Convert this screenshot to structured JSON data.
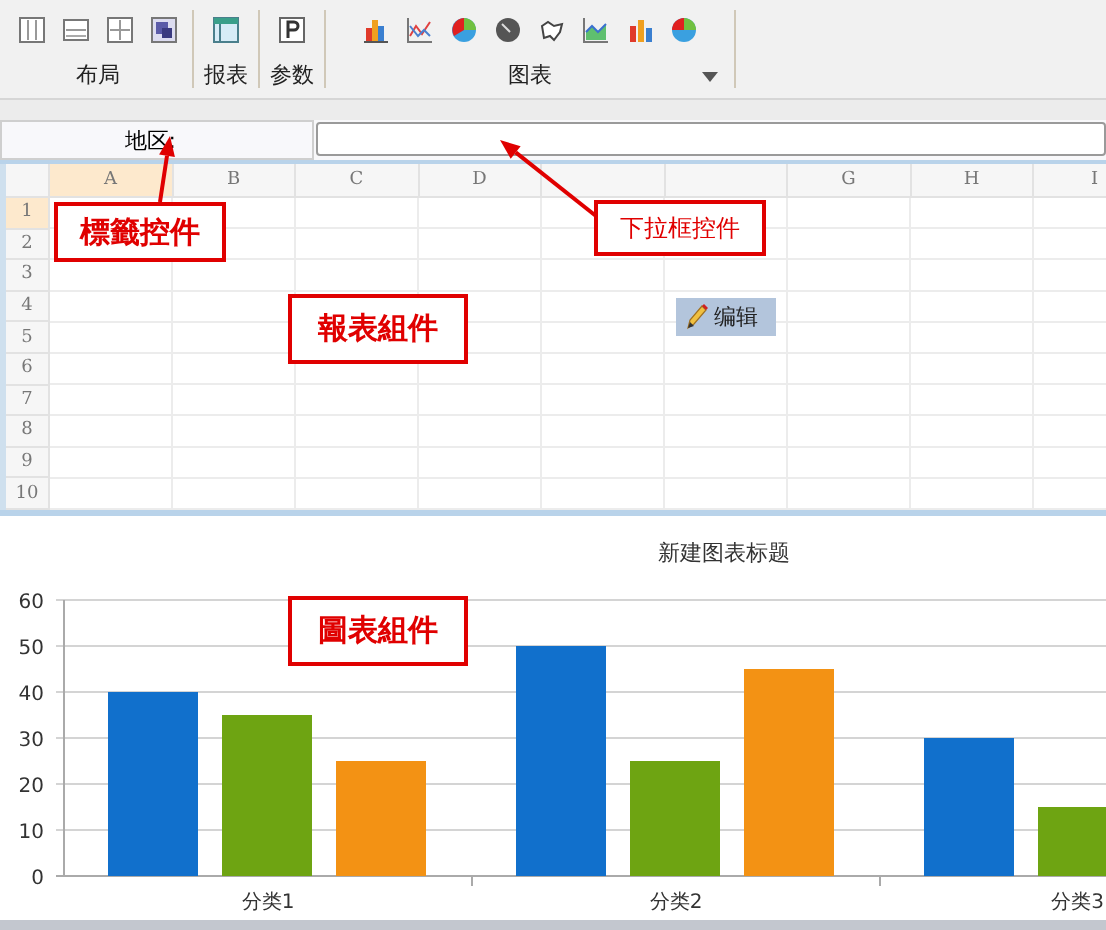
{
  "toolbar": {
    "groups": [
      {
        "label": "布局",
        "has_menu": false
      },
      {
        "label": "报表",
        "has_menu": false
      },
      {
        "label": "参数",
        "has_menu": false
      },
      {
        "label": "图表",
        "has_menu": true
      }
    ]
  },
  "form": {
    "label": "地区:"
  },
  "sheet": {
    "columns": [
      {
        "label": "A",
        "selected": true
      },
      {
        "label": "B",
        "selected": false
      },
      {
        "label": "C",
        "selected": false
      },
      {
        "label": "D",
        "selected": false
      },
      null,
      null,
      {
        "label": "G",
        "selected": false
      },
      {
        "label": "H",
        "selected": false
      },
      {
        "label": "I",
        "selected": false
      }
    ],
    "rows": [
      {
        "label": "1",
        "selected": true
      },
      {
        "label": "2",
        "selected": false
      },
      {
        "label": "3",
        "selected": false
      },
      {
        "label": "4",
        "selected": false
      },
      {
        "label": "5",
        "selected": false
      },
      {
        "label": "6",
        "selected": false
      },
      {
        "label": "7",
        "selected": false
      },
      {
        "label": "8",
        "selected": false
      },
      {
        "label": "9",
        "selected": false
      },
      {
        "label": "10",
        "selected": false
      }
    ],
    "edit_button": "编辑"
  },
  "chart": {
    "chart_data": {
      "type": "bar",
      "title": "新建图表标题",
      "categories": [
        "分类1",
        "分类2",
        "分类3"
      ],
      "series": [
        {
          "color": "#1170cc",
          "values": [
            40,
            50,
            30
          ]
        },
        {
          "color": "#6ea412",
          "values": [
            35,
            25,
            15
          ]
        },
        {
          "color": "#f39214",
          "values": [
            25,
            45,
            null
          ]
        }
      ],
      "grid": true,
      "ylim": [
        0,
        60
      ],
      "yticks": [
        0,
        10,
        20,
        30,
        40,
        50,
        60
      ]
    }
  },
  "annotations": [
    {
      "text": "標籤控件",
      "kind": "label-callout"
    },
    {
      "text": "下拉框控件",
      "kind": "dropdown-callout"
    },
    {
      "text": "報表組件",
      "kind": "plain"
    },
    {
      "text": "圖表組件",
      "kind": "plain"
    }
  ]
}
